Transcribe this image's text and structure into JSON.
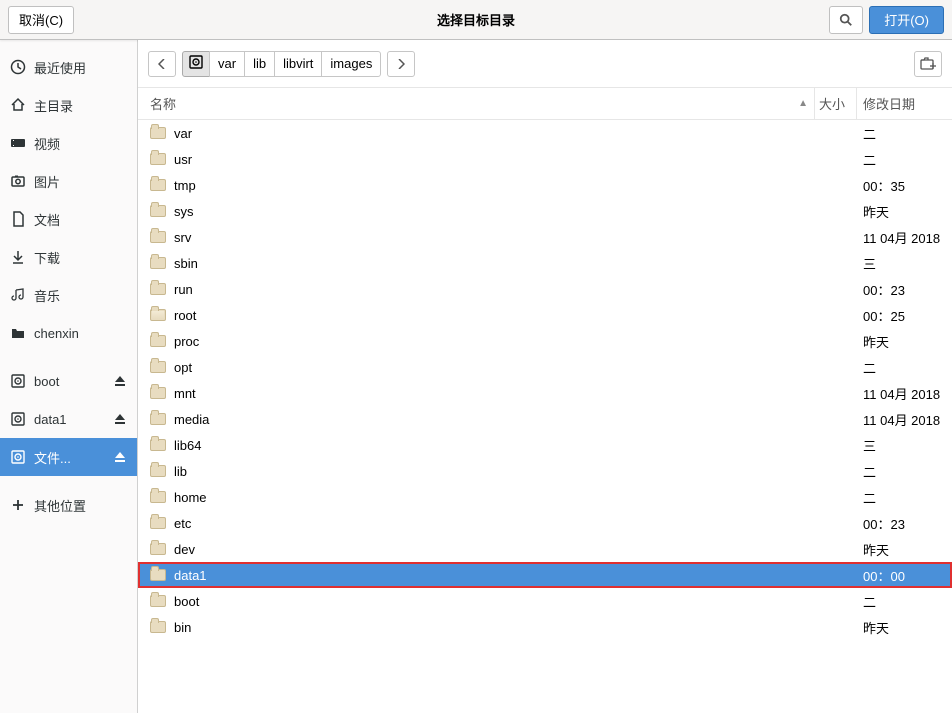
{
  "header": {
    "cancel_label": "取消(C)",
    "title": "选择目标目录",
    "open_label": "打开(O)"
  },
  "sidebar": {
    "items": [
      {
        "icon": "clock",
        "label": "最近使用",
        "eject": false,
        "selected": false
      },
      {
        "icon": "home",
        "label": "主目录",
        "eject": false,
        "selected": false
      },
      {
        "icon": "video",
        "label": "视频",
        "eject": false,
        "selected": false
      },
      {
        "icon": "photo",
        "label": "图片",
        "eject": false,
        "selected": false
      },
      {
        "icon": "doc",
        "label": "文档",
        "eject": false,
        "selected": false
      },
      {
        "icon": "download",
        "label": "下载",
        "eject": false,
        "selected": false
      },
      {
        "icon": "music",
        "label": "音乐",
        "eject": false,
        "selected": false
      },
      {
        "icon": "folder",
        "label": "chenxin",
        "eject": false,
        "selected": false
      },
      {
        "icon": "disk",
        "label": "boot",
        "eject": true,
        "selected": false
      },
      {
        "icon": "disk",
        "label": "data1",
        "eject": true,
        "selected": false
      },
      {
        "icon": "disk",
        "label": "文件...",
        "eject": true,
        "selected": true
      },
      {
        "icon": "plus",
        "label": "其他位置",
        "eject": false,
        "selected": false
      }
    ]
  },
  "pathbar": {
    "back_icon": "chevron-left",
    "segments": [
      {
        "label": "",
        "icon": "disk",
        "selected": true
      },
      {
        "label": "var",
        "selected": false
      },
      {
        "label": "lib",
        "selected": false
      },
      {
        "label": "libvirt",
        "selected": false
      },
      {
        "label": "images",
        "selected": false
      }
    ],
    "forward_icon": "chevron-right",
    "create_folder_icon": "new-folder"
  },
  "columns": {
    "name": "名称",
    "size": "大小",
    "modified": "修改日期"
  },
  "files": [
    {
      "name": "var",
      "date": "二",
      "selected": false,
      "highlight": false
    },
    {
      "name": "usr",
      "date": "二",
      "selected": false,
      "highlight": false
    },
    {
      "name": "tmp",
      "date": "00：35",
      "selected": false,
      "highlight": false
    },
    {
      "name": "sys",
      "date": "昨天",
      "selected": false,
      "highlight": false
    },
    {
      "name": "srv",
      "date": "11 04月 2018",
      "selected": false,
      "highlight": false
    },
    {
      "name": "sbin",
      "date": "三",
      "selected": false,
      "highlight": false
    },
    {
      "name": "run",
      "date": "00：23",
      "selected": false,
      "highlight": false
    },
    {
      "name": "root",
      "date": "00：25",
      "selected": false,
      "highlight": false,
      "home": true
    },
    {
      "name": "proc",
      "date": "昨天",
      "selected": false,
      "highlight": false
    },
    {
      "name": "opt",
      "date": "二",
      "selected": false,
      "highlight": false
    },
    {
      "name": "mnt",
      "date": "11 04月 2018",
      "selected": false,
      "highlight": false
    },
    {
      "name": "media",
      "date": "11 04月 2018",
      "selected": false,
      "highlight": false
    },
    {
      "name": "lib64",
      "date": "三",
      "selected": false,
      "highlight": false
    },
    {
      "name": "lib",
      "date": "二",
      "selected": false,
      "highlight": false
    },
    {
      "name": "home",
      "date": "二",
      "selected": false,
      "highlight": false
    },
    {
      "name": "etc",
      "date": "00：23",
      "selected": false,
      "highlight": false
    },
    {
      "name": "dev",
      "date": "昨天",
      "selected": false,
      "highlight": false
    },
    {
      "name": "data1",
      "date": "00：00",
      "selected": true,
      "highlight": true
    },
    {
      "name": "boot",
      "date": "二",
      "selected": false,
      "highlight": false
    },
    {
      "name": "bin",
      "date": "昨天",
      "selected": false,
      "highlight": false
    }
  ]
}
